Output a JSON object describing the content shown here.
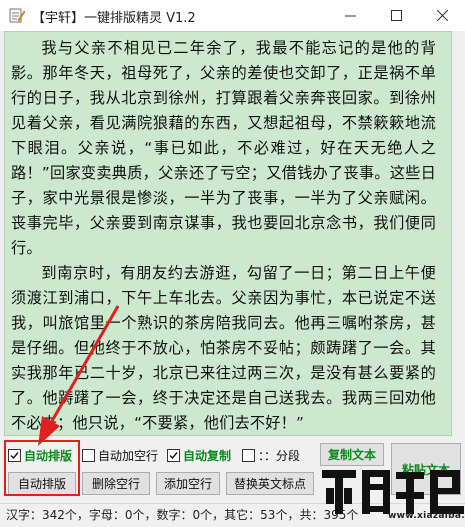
{
  "window": {
    "title": "【宇轩】一键排版精灵 V1.2",
    "minimize_label": "—",
    "maximize_label": "☐",
    "close_label": "✕"
  },
  "editor": {
    "paragraphs": [
      "我与父亲不相见已二年余了，我最不能忘记的是他的背影。那年冬天，祖母死了，父亲的差使也交卸了，正是祸不单行的日子，我从北京到徐州，打算跟着父亲奔丧回家。到徐州见着父亲，看见满院狼藉的东西，又想起祖母，不禁簌簌地流下眼泪。父亲说，“事已如此，不必难过，好在天无绝人之路！”回家变卖典质，父亲还了亏空；又借钱办了丧事。这些日子，家中光景很是惨淡，一半为了丧事，一半为了父亲赋闲。丧事完毕，父亲要到南京谋事，我也要回北京念书，我们便同行。",
      "到南京时，有朋友约去游逛，勾留了一日；第二日上午便须渡江到浦口，下午上车北去。父亲因为事忙，本已说定不送我，叫旅馆里一个熟识的茶房陪我同去。他再三嘱咐茶房，甚是仔细。但他终于不放心，怕茶房不妥帖；颇踌躇了一会。其实我那年已二十岁，北京已来往过两三次，是没有甚么要紧的了。他踌躇了一会，终于决定还是自己送我去。我两三回劝他不必去；他只说，“不要紧，他们去不好！”"
    ]
  },
  "options": {
    "auto_format": {
      "label": "自动排版",
      "checked": true
    },
    "auto_blank_line": {
      "label": "自动加空行",
      "checked": false
    },
    "auto_copy": {
      "label": "自动复制",
      "checked": true
    },
    "segment": {
      "label": "：：分段",
      "checked": false
    }
  },
  "buttons": {
    "copy_text": "复制文本",
    "paste_text": "粘贴文本",
    "auto_format": "自动排版",
    "delete_blank": "删除空行",
    "add_blank": "添加空行",
    "replace_punct": "替换英文标点"
  },
  "status": {
    "text": "汉字：342个，字母：0个，数字：0个，其它：53个，共：395个"
  },
  "watermark": {
    "domain": "www.xiazaiba.com"
  },
  "colors": {
    "editor_bg": "#cce8cf",
    "accent_green": "#0a8a1f",
    "highlight_red": "#e02020"
  }
}
